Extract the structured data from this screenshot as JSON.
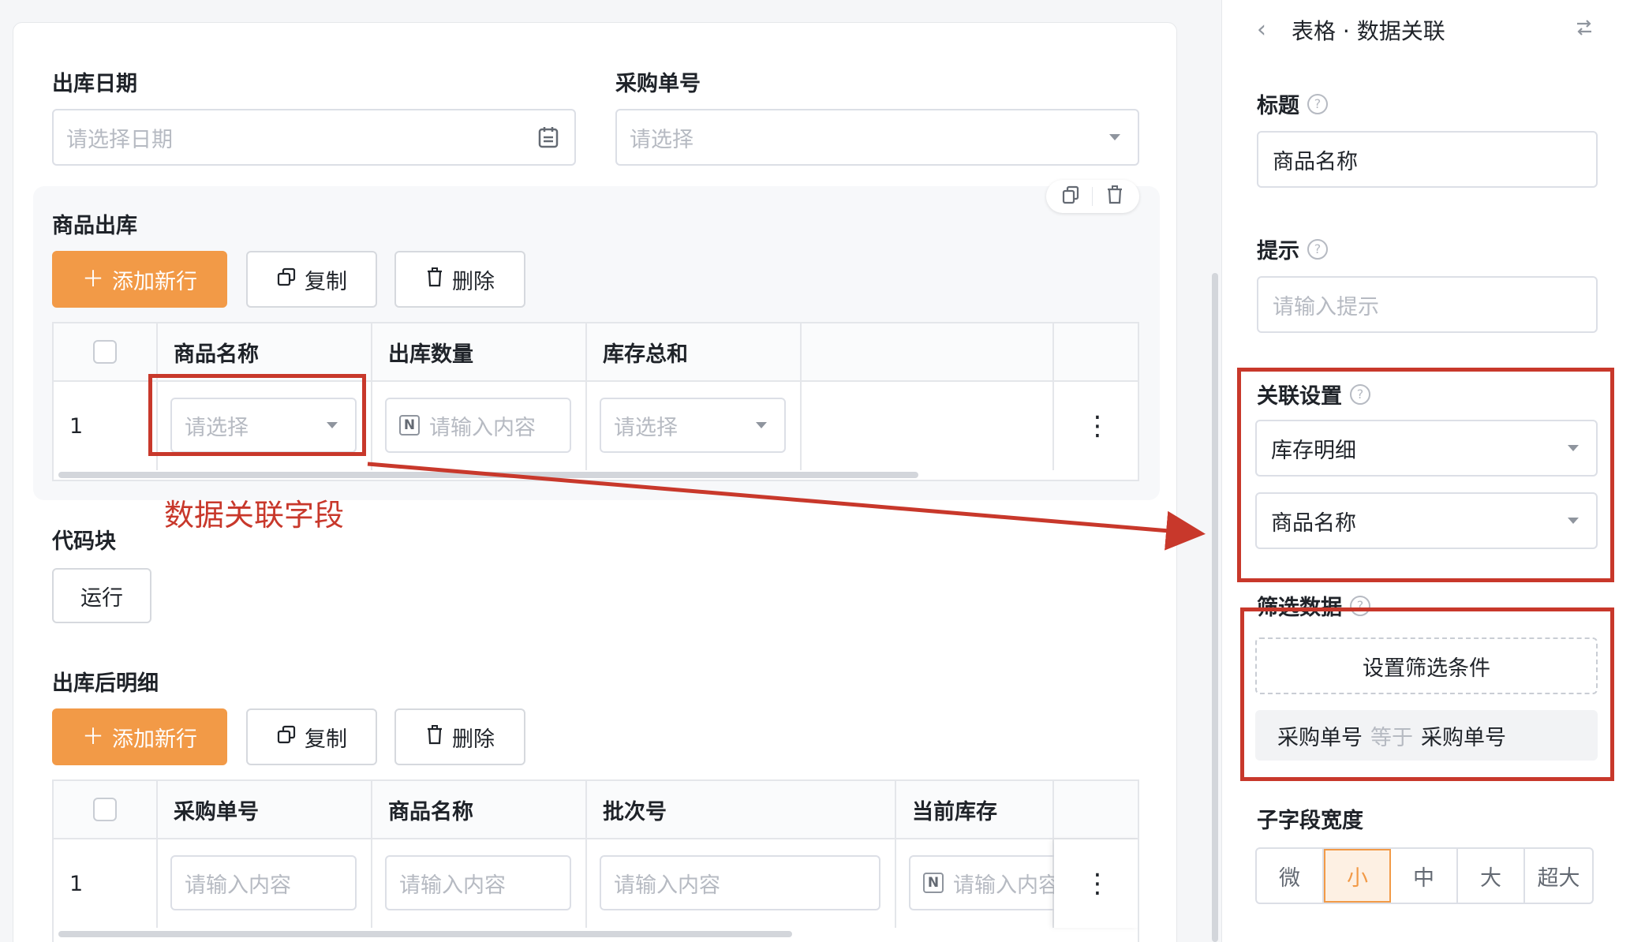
{
  "form": {
    "date_label": "出库日期",
    "date_placeholder": "请选择日期",
    "po_label": "采购单号",
    "po_placeholder": "请选择",
    "section1": {
      "title": "商品出库",
      "add_button": "添加新行",
      "copy_button": "复制",
      "delete_button": "删除",
      "columns": [
        "商品名称",
        "出库数量",
        "库存总和"
      ],
      "row": {
        "index": "1",
        "product_placeholder": "请选择",
        "qty_placeholder": "请输入内容",
        "stock_placeholder": "请选择"
      }
    },
    "annotation": "数据关联字段",
    "code_block": {
      "title": "代码块",
      "run_button": "运行"
    },
    "section2": {
      "title": "出库后明细",
      "add_button": "添加新行",
      "copy_button": "复制",
      "delete_button": "删除",
      "columns": [
        "采购单号",
        "商品名称",
        "批次号",
        "当前库存"
      ],
      "row": {
        "index": "1",
        "c1_placeholder": "请输入内容",
        "c2_placeholder": "请输入内容",
        "c3_placeholder": "请输入内容",
        "c4_placeholder": "请输入内容"
      }
    }
  },
  "panel": {
    "header": "表格 · 数据关联",
    "title_label": "标题",
    "title_value": "商品名称",
    "hint_label": "提示",
    "hint_placeholder": "请输入提示",
    "relation_label": "关联设置",
    "relation_table": "库存明细",
    "relation_field": "商品名称",
    "filter_label": "筛选数据",
    "filter_button": "设置筛选条件",
    "condition": {
      "left": "采购单号",
      "op": "等于",
      "right": "采购单号"
    },
    "width_label": "子字段宽度",
    "width_options": [
      "微",
      "小",
      "中",
      "大",
      "超大"
    ],
    "width_selected": "小"
  },
  "colors": {
    "primary": "#f29a47",
    "annotation_red": "#c8382b"
  },
  "icons": [
    "calendar-icon",
    "chevron-down-icon",
    "copy-icon",
    "trash-icon",
    "plus-icon",
    "number-field-icon",
    "more-vertical-icon",
    "back-chevron-icon",
    "swap-icon",
    "help-icon"
  ]
}
